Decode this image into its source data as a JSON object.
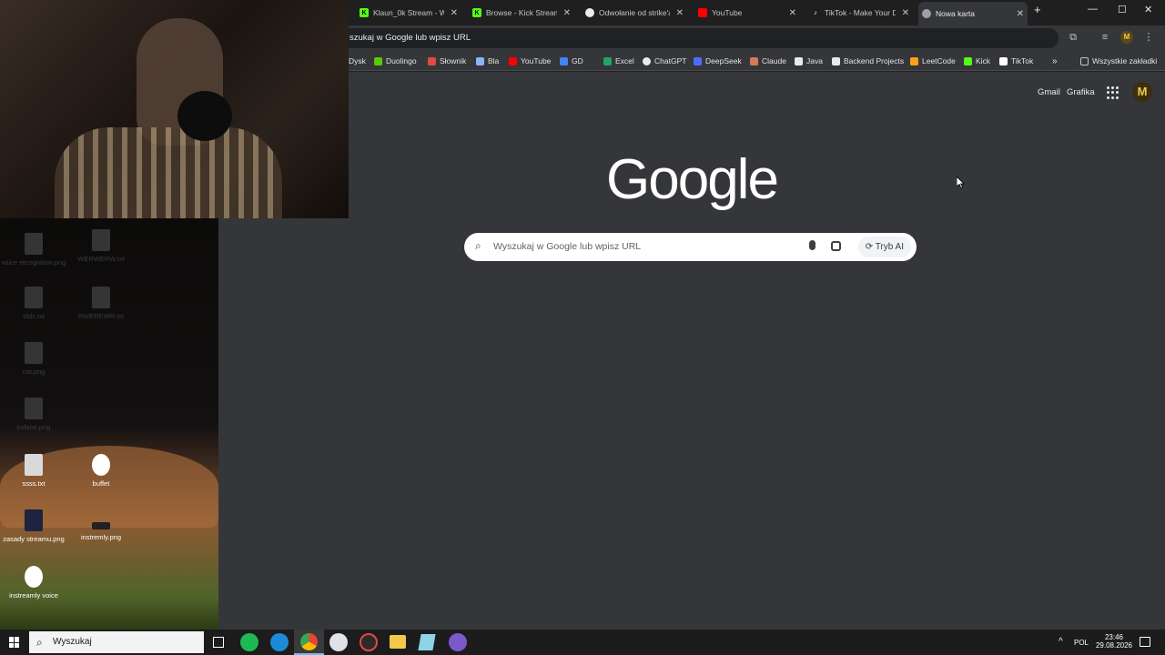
{
  "browser": {
    "tabs": [
      {
        "title": "Klaun_0k Stream - Wa",
        "icon": "kick-icon",
        "color": "#53fc18"
      },
      {
        "title": "Browse - Kick Stream",
        "icon": "kick-icon",
        "color": "#53fc18"
      },
      {
        "title": "Odwołanie od strike'a",
        "icon": "chatgpt-icon",
        "color": "#e8eaed"
      },
      {
        "title": "YouTube",
        "icon": "youtube-icon",
        "color": "#ff0000"
      },
      {
        "title": "TikTok - Make Your Da",
        "icon": "tiktok-icon",
        "color": "#ffffff"
      },
      {
        "title": "Nowa karta",
        "icon": "chrome-icon",
        "color": "#9aa0a6",
        "active": true
      }
    ],
    "new_tab": "+",
    "omnibox_text": "szukaj w Google lub wpisz URL",
    "profile_initial": "M",
    "bookmarks": [
      {
        "label": "Dysk",
        "color": "#4285f4"
      },
      {
        "label": "Duolingo",
        "color": "#58cc02"
      },
      {
        "label": "Słownik",
        "color": "#e34a3f"
      },
      {
        "label": "Bla",
        "color": "#8ab4f8"
      },
      {
        "label": "YouTube",
        "color": "#ff0000"
      },
      {
        "label": "GD",
        "color": "#4285f4"
      },
      {
        "label": "Excel",
        "color": "#21a366"
      },
      {
        "label": "ChatGPT",
        "color": "#e8eaed"
      },
      {
        "label": "DeepSeek",
        "color": "#4d6bfe"
      },
      {
        "label": "Claude",
        "color": "#d97757"
      },
      {
        "label": "Java",
        "color": "#e8eaed"
      },
      {
        "label": "Backend Projects",
        "color": "#e8eaed"
      },
      {
        "label": "LeetCode",
        "color": "#ffa116"
      },
      {
        "label": "Kick",
        "color": "#53fc18"
      },
      {
        "label": "TikTok",
        "color": "#ffffff"
      }
    ],
    "bookmarks_overflow": "»",
    "all_bookmarks": "Wszystkie zakładki"
  },
  "page": {
    "gmail": "Gmail",
    "images": "Grafika",
    "avatar": "M",
    "logo": "Google",
    "search_placeholder": "Wyszukaj w Google lub wpisz URL",
    "ai_mode": "Tryb AI"
  },
  "desktop": {
    "icons": [
      {
        "label": "voice recognition.png",
        "dim": true
      },
      {
        "label": "WERWERW.txt",
        "dim": true
      },
      {
        "label": "sfds.txt",
        "dim": true
      },
      {
        "label": "RWEREWR.txt",
        "dim": true
      },
      {
        "label": "cat.png",
        "dim": true
      },
      {
        "label": "kolone.png",
        "dim": true
      },
      {
        "label": "ssss.txt",
        "dim": false
      },
      {
        "label": "buffet",
        "dim": false
      },
      {
        "label": "zasady streamu.png",
        "dim": false
      },
      {
        "label": "instremly.png",
        "dim": false
      },
      {
        "label": "instreamly voice",
        "dim": false
      }
    ]
  },
  "taskbar": {
    "search_label": "Wyszukaj",
    "lang": "POL",
    "time": "23:46",
    "date": "29.08.2026"
  }
}
